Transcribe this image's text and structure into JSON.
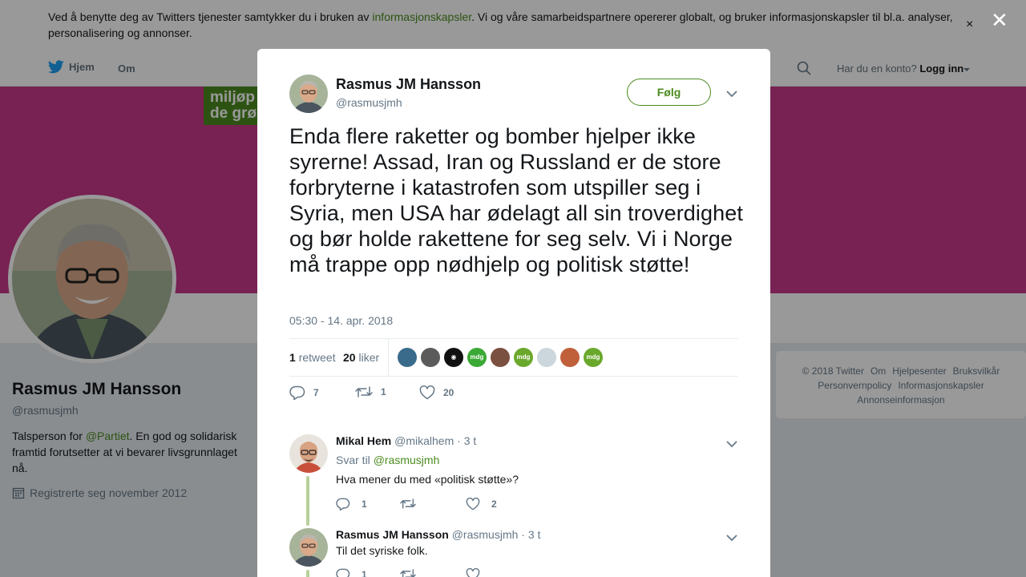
{
  "cookie_banner": {
    "text_before": "Ved å benytte deg av Twitters tjenester samtykker du i bruken av ",
    "link": "informasjonskapsler",
    "text_after": ". Vi og våre samarbeidspartnere opererer globalt, og bruker informasjonskapsler til bl.a. analyser, personalisering og annonser.",
    "close": "×"
  },
  "nav": {
    "home": "Hjem",
    "about": "Om",
    "account_prompt": "Har du en konto?",
    "login": "Logg inn"
  },
  "banner": {
    "logo_line1": "miljøp",
    "logo_line2": "de grø",
    "color": "#c8388a",
    "logo_color": "#4b8b1f"
  },
  "profile": {
    "name": "Rasmus JM Hansson",
    "handle": "@rasmusjmh",
    "bio_before": "Talsperson for ",
    "bio_link": "@Partiet",
    "bio_after": ". En god og solidarisk framtid forutsetter at vi bevarer livsgrunnlaget nå.",
    "joined": "Registrerte seg november 2012"
  },
  "footer": {
    "items": [
      "© 2018 Twitter",
      "Om",
      "Hjelpesenter",
      "Bruksvilkår",
      "Personvernpolicy",
      "Informasjonskapsler",
      "Annonseinformasjon"
    ]
  },
  "modal": {
    "close": "✕",
    "tweet": {
      "author_name": "Rasmus JM Hansson",
      "author_handle": "@rasmusjmh",
      "follow_label": "Følg",
      "text": "Enda flere raketter og bomber hjelper ikke syrerne! Assad, Iran og Russland er de store forbryterne i katastrofen som utspiller seg i Syria, men USA har ødelagt all sin troverdighet og bør holde rakettene for seg selv. Vi i Norge må trappe opp nødhjelp og politisk støtte!",
      "timestamp": "05:30 - 14. apr. 2018",
      "retweet_count": "1",
      "retweet_label": "retweet",
      "like_count": "20",
      "like_label": "liker",
      "likers": [
        {
          "label": "",
          "color": "#3b6b8a"
        },
        {
          "label": "",
          "color": "#5b5b5b"
        },
        {
          "label": "◉",
          "color": "#111111"
        },
        {
          "label": "mdg",
          "color": "#3aa935"
        },
        {
          "label": "",
          "color": "#7a5040"
        },
        {
          "label": "mdg",
          "color": "#6aa82c"
        },
        {
          "label": "",
          "color": "#ccd6dd"
        },
        {
          "label": "",
          "color": "#c0603a"
        },
        {
          "label": "mdg",
          "color": "#6aa82c"
        }
      ],
      "replies": "7",
      "retweets": "1",
      "likes": "20"
    },
    "replies": [
      {
        "name": "Mikal Hem",
        "handle": "@mikalhem",
        "time": "· 3 t",
        "reply_to_label": "Svar til",
        "reply_to": "@rasmusjmh",
        "text": "Hva mener du med «politisk støtte»?",
        "replies": "1",
        "retweets": "",
        "likes": "2"
      },
      {
        "name": "Rasmus JM Hansson",
        "handle": "@rasmusjmh",
        "time": "· 3 t",
        "text": "Til det syriske folk.",
        "replies": "1",
        "retweets": "",
        "likes": ""
      }
    ]
  },
  "colors": {
    "accent": "#4b8b1f",
    "thread_line": "#b7d19a",
    "overlay": "rgba(0,0,0,0.4)"
  }
}
